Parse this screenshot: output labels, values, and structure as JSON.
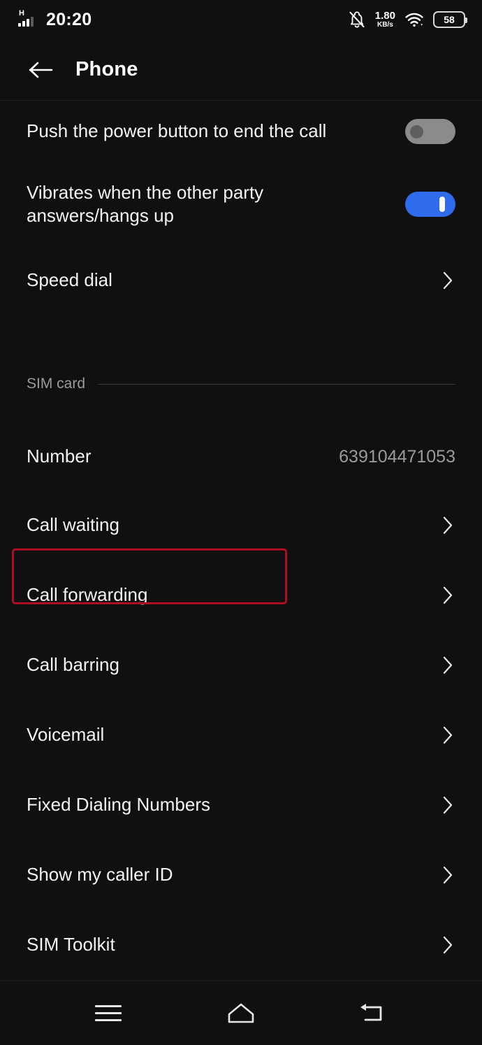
{
  "status_bar": {
    "network_type": "H",
    "time": "20:20",
    "network_speed_value": "1.80",
    "network_speed_unit": "KB/s",
    "battery_level": "58",
    "icons": [
      "signal-bars-icon",
      "bell-muted-icon",
      "wifi-icon",
      "battery-icon"
    ]
  },
  "app_bar": {
    "back_icon": "back-arrow-icon",
    "title": "Phone"
  },
  "settings": {
    "general_rows": [
      {
        "label": "Push the power button to end the call",
        "control": "toggle",
        "state": "off"
      },
      {
        "label": "Vibrates when the other party answers/hangs up",
        "control": "toggle",
        "state": "on"
      },
      {
        "label": "Speed dial",
        "control": "chevron"
      }
    ],
    "sim_section": {
      "title": "SIM card",
      "rows": [
        {
          "label": "Number",
          "value": "639104471053",
          "control": "value"
        },
        {
          "label": "Call waiting",
          "control": "chevron"
        },
        {
          "label": "Call forwarding",
          "control": "chevron",
          "highlighted": true
        },
        {
          "label": "Call barring",
          "control": "chevron"
        },
        {
          "label": "Voicemail",
          "control": "chevron"
        },
        {
          "label": "Fixed Dialing Numbers",
          "control": "chevron"
        },
        {
          "label": "Show my caller ID",
          "control": "chevron"
        },
        {
          "label": "SIM Toolkit",
          "control": "chevron"
        }
      ]
    }
  },
  "nav_bar": {
    "recents_icon": "menu-icon",
    "home_icon": "home-icon",
    "back_icon": "back-icon"
  },
  "colors": {
    "background": "#101010",
    "accent_toggle_on": "#2f6bed",
    "toggle_off": "#8b8b8b",
    "highlight_border": "#ab1022",
    "primary_text": "#f2f2f2",
    "secondary_text": "#9a9a9a"
  }
}
